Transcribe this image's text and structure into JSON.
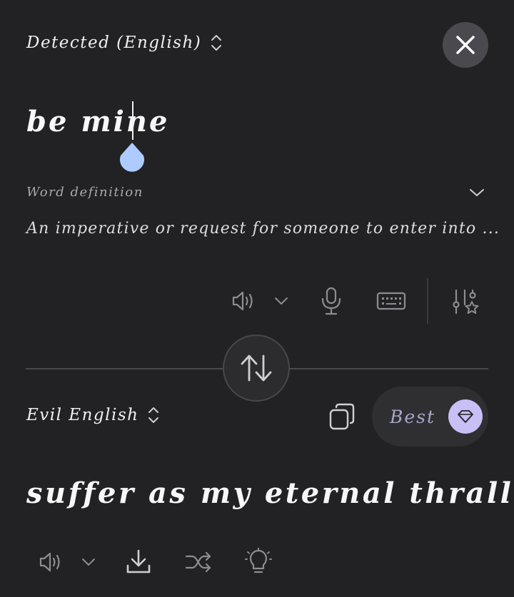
{
  "source": {
    "language_label": "Detected (English)",
    "text": "be mine"
  },
  "definition": {
    "label": "Word definition",
    "text": "An imperative or request for someone to enter into ..."
  },
  "target": {
    "language_label": "Evil English",
    "text": "suffer as my eternal thrall",
    "mode_label": "Best"
  },
  "icons": {
    "close": "close-icon",
    "swap": "swap-arrows-icon",
    "speaker": "speaker-icon",
    "microphone": "microphone-icon",
    "keyboard": "keyboard-icon",
    "settings": "sliders-star-icon",
    "copy": "copy-icon",
    "gem": "gem-icon",
    "download": "download-icon",
    "shuffle": "shuffle-icon",
    "lightbulb": "lightbulb-icon"
  },
  "colors": {
    "background": "#222224",
    "cursor_handle": "#aecbff",
    "gem_accent": "#c8bff6"
  }
}
